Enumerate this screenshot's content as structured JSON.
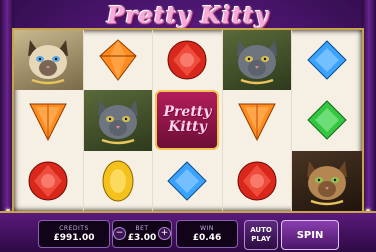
{
  "game": {
    "logo": "Pretty Kitty",
    "logo_tile_lines": [
      "Pretty",
      "Kitty"
    ]
  },
  "reels": [
    [
      "siamese-cat",
      "orange-diamond",
      "red-gem",
      "gray-cat",
      "blue-gem"
    ],
    [
      "orange-gem",
      "gray-cat",
      "pretty-kitty-logo",
      "orange-gem",
      "green-gem"
    ],
    [
      "red-gem",
      "yellow-diamond",
      "blue-gem",
      "red-gem",
      "tabby-cat"
    ]
  ],
  "bottom_bar": {
    "credits": {
      "label": "CREDITS",
      "value": "£991.00"
    },
    "bet": {
      "label": "BET",
      "value": "£3.00",
      "minus": "−",
      "plus": "+"
    },
    "win": {
      "label": "WIN",
      "value": "£0.46"
    },
    "autoplay_label": "AUTO PLAY",
    "spin_label": "SPIN"
  },
  "colors": {
    "accent": "#c9a24a",
    "panel": "#120418",
    "bar": "#4b1670"
  }
}
